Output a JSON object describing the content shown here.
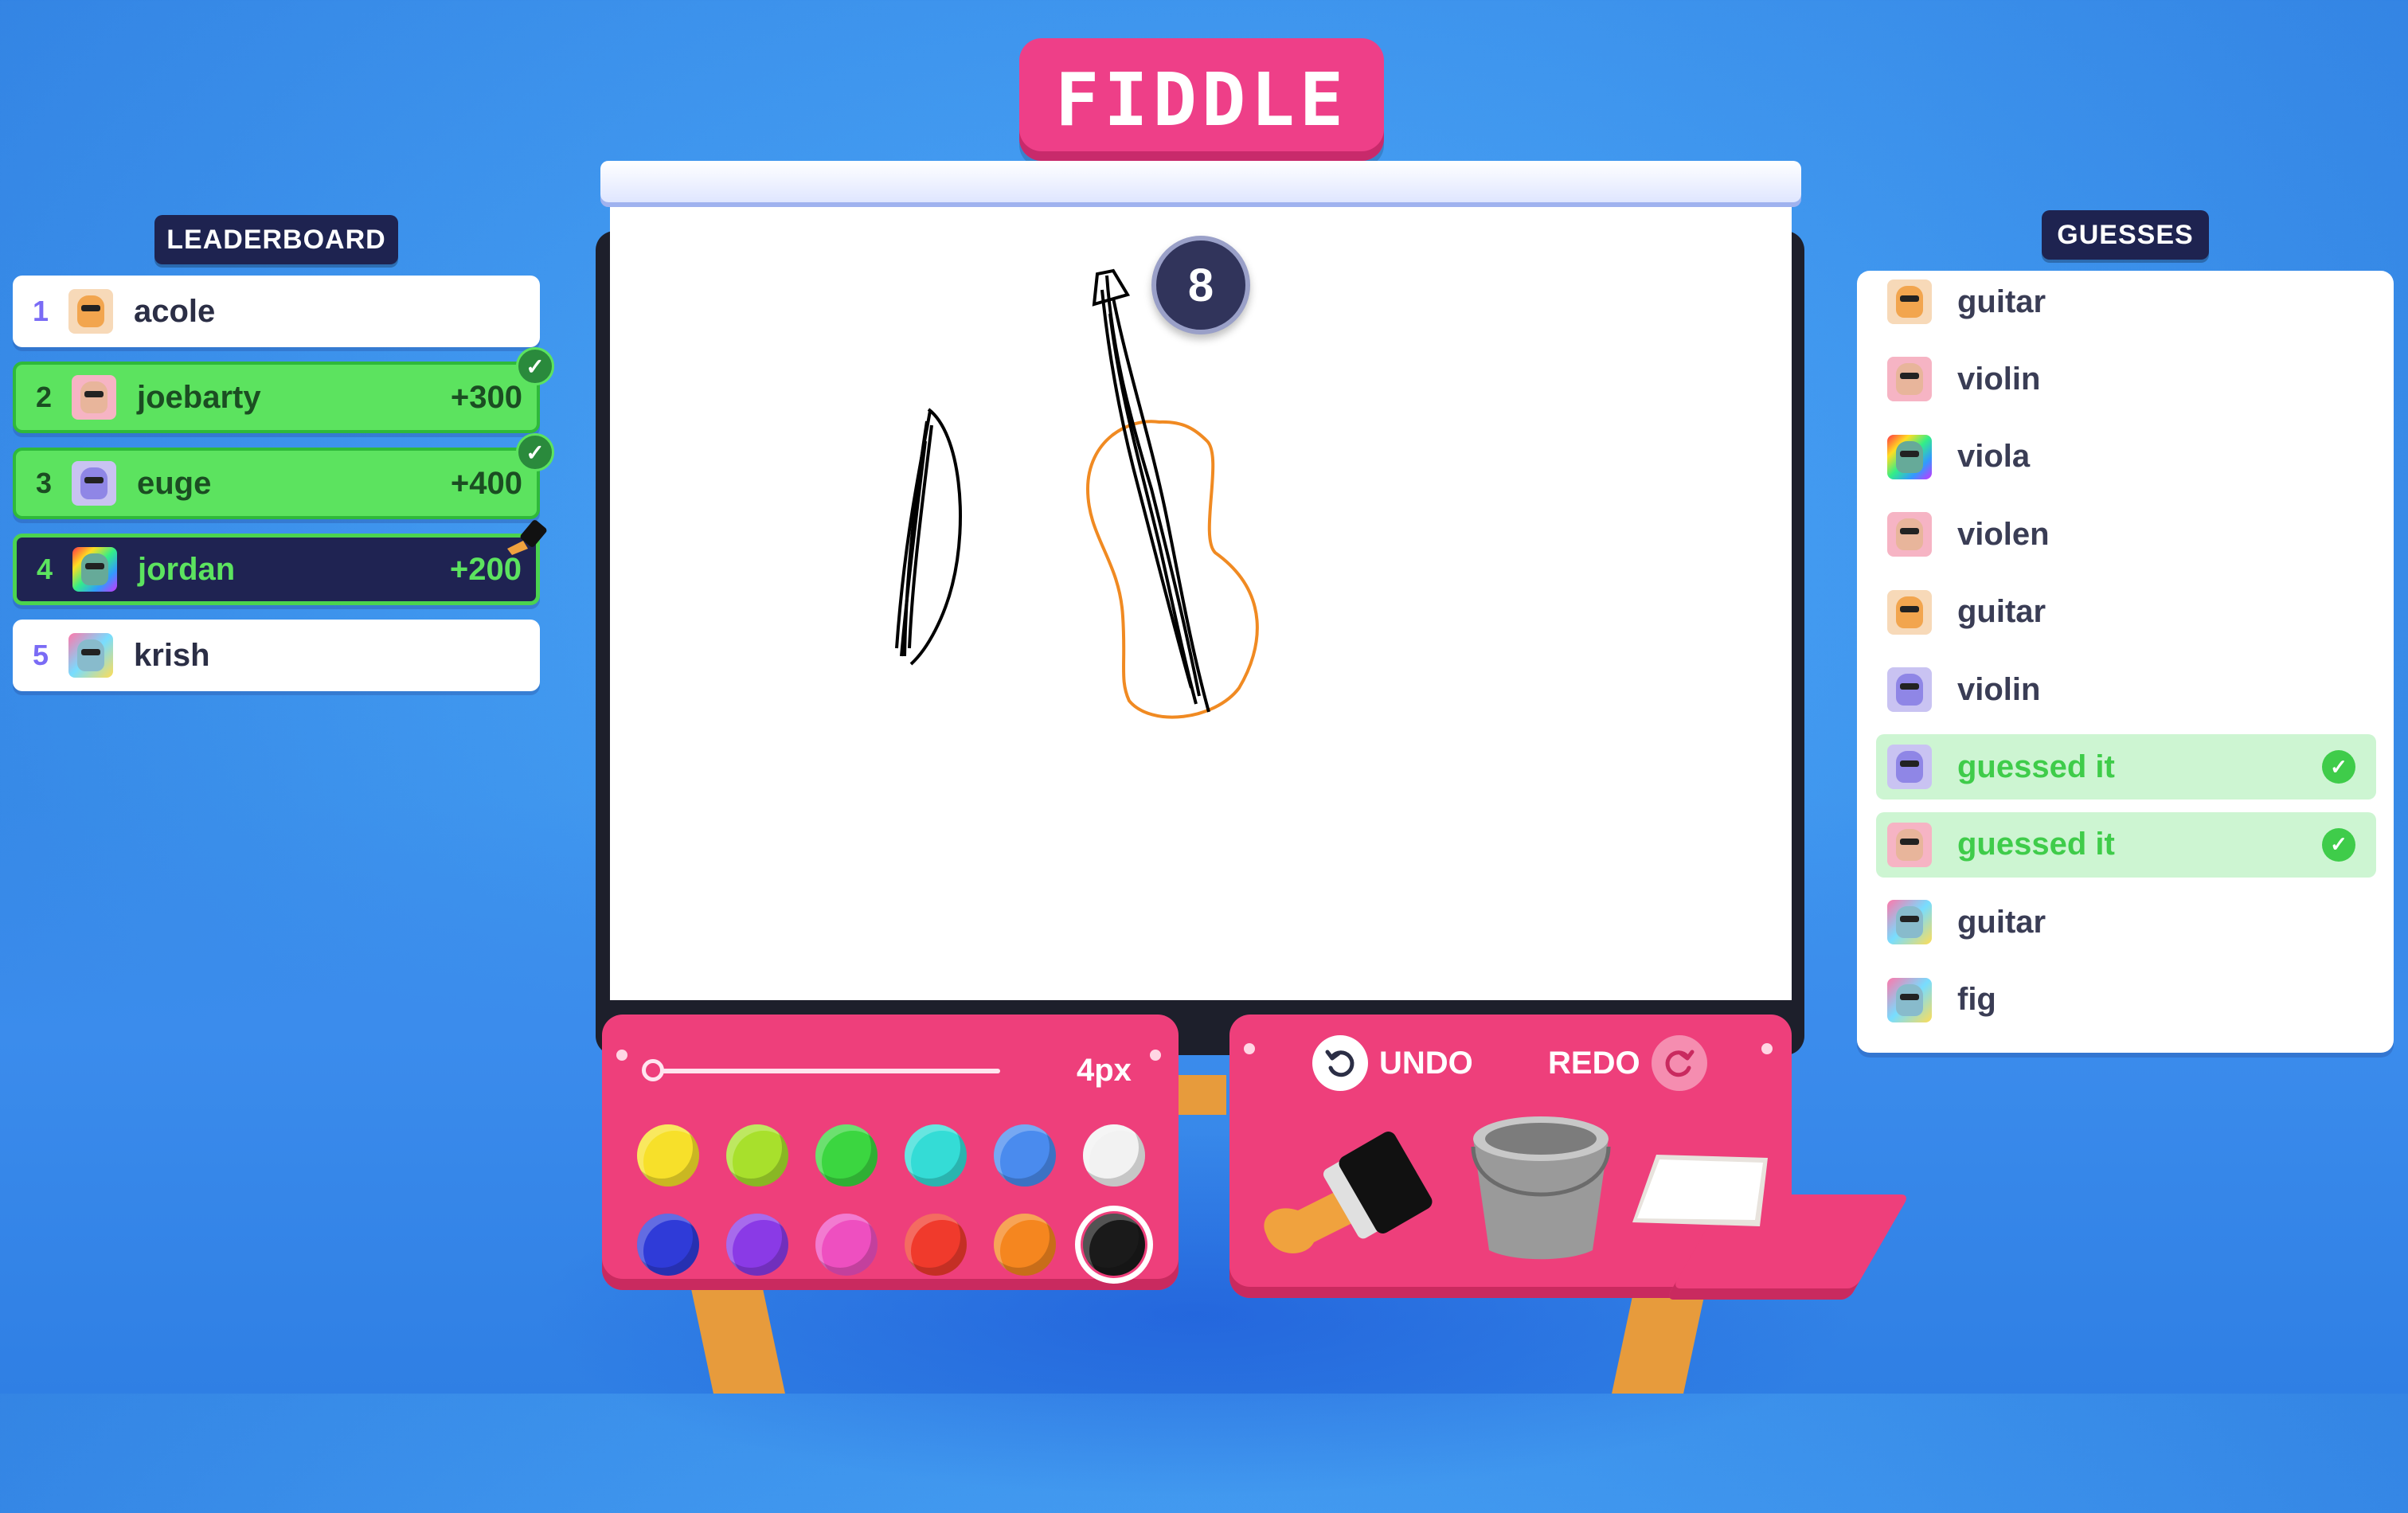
{
  "title": "FIDDLE",
  "timer": "8",
  "leaderboard": {
    "label": "LEADERBOARD",
    "players": [
      {
        "rank": "1",
        "name": "acole",
        "score": "",
        "state": "normal",
        "avatar": "orange"
      },
      {
        "rank": "2",
        "name": "joebarty",
        "score": "+300",
        "state": "correct",
        "avatar": "pink"
      },
      {
        "rank": "3",
        "name": "euge",
        "score": "+400",
        "state": "correct",
        "avatar": "purple"
      },
      {
        "rank": "4",
        "name": "jordan",
        "score": "+200",
        "state": "drawer",
        "avatar": "rainbow"
      },
      {
        "rank": "5",
        "name": "krish",
        "score": "",
        "state": "normal",
        "avatar": "multi"
      }
    ]
  },
  "guesses": {
    "label": "GUESSES",
    "items": [
      {
        "text": "guitar",
        "avatar": "orange",
        "correct": false
      },
      {
        "text": "violin",
        "avatar": "pink",
        "correct": false
      },
      {
        "text": "viola",
        "avatar": "rainbow",
        "correct": false
      },
      {
        "text": "violen",
        "avatar": "pink",
        "correct": false
      },
      {
        "text": "guitar",
        "avatar": "orange",
        "correct": false
      },
      {
        "text": "violin",
        "avatar": "purple",
        "correct": false
      },
      {
        "text": "guessed it",
        "avatar": "purple",
        "correct": true
      },
      {
        "text": "guessed it",
        "avatar": "pink",
        "correct": true
      },
      {
        "text": "guitar",
        "avatar": "multi",
        "correct": false
      },
      {
        "text": "fig",
        "avatar": "multi",
        "correct": false
      }
    ]
  },
  "brush": {
    "size_label": "4px",
    "size_fraction": 0.0,
    "colors": [
      "#f7e02a",
      "#a8e02c",
      "#3bd640",
      "#34dcd6",
      "#4a8bee",
      "#f2f2f2",
      "#2f3bd8",
      "#8a3ae6",
      "#ee4fc0",
      "#f03a2c",
      "#f5861f",
      "#1a1a1a"
    ],
    "selected_index": 11
  },
  "actions": {
    "undo": "UNDO",
    "redo": "REDO"
  }
}
